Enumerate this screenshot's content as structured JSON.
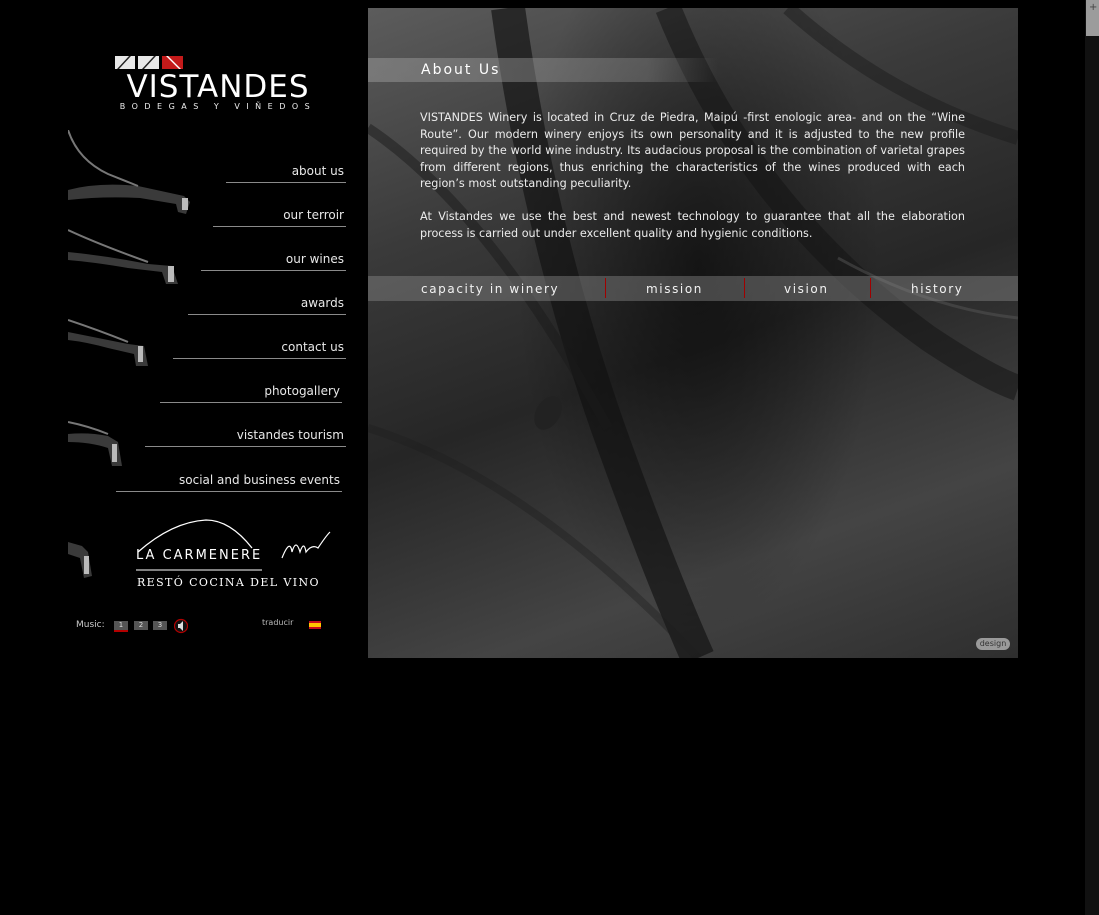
{
  "logo": {
    "name": "VISTANDES",
    "tagline": "BODEGAS Y VIÑEDOS"
  },
  "nav": {
    "items": [
      {
        "label": "about us"
      },
      {
        "label": "our terroir"
      },
      {
        "label": "our wines"
      },
      {
        "label": "awards"
      },
      {
        "label": "contact us"
      },
      {
        "label": "photogallery"
      },
      {
        "label": "vistandes tourism"
      },
      {
        "label": "social and business events"
      }
    ]
  },
  "restaurant": {
    "name": "LA CARMENERE",
    "tagline": "RESTÓ COCINA DEL VINO"
  },
  "music": {
    "label": "Music:",
    "tracks": [
      "1",
      "2",
      "3"
    ],
    "active_track": "1"
  },
  "translate": {
    "label": "traducir"
  },
  "content": {
    "title": "About Us",
    "paragraphs": [
      "VISTANDES Winery is located in Cruz de Piedra, Maipú -first enologic area- and on the “Wine Route”. Our modern winery enjoys its own personality and it is adjusted to the new profile required by the world wine industry. Its audacious proposal is the combination of varietal grapes from different regions, thus enriching the characteristics of the wines produced with each region’s most outstanding peculiarity.",
      "At Vistandes we use the best and newest technology to guarantee that all the elaboration process is carried out under excellent quality and hygienic conditions."
    ],
    "tabs": [
      {
        "label": "capacity in winery"
      },
      {
        "label": "mission"
      },
      {
        "label": "vision"
      },
      {
        "label": "history"
      }
    ],
    "design_badge": "design"
  },
  "colors": {
    "accent": "#b30000",
    "background": "#000000"
  }
}
